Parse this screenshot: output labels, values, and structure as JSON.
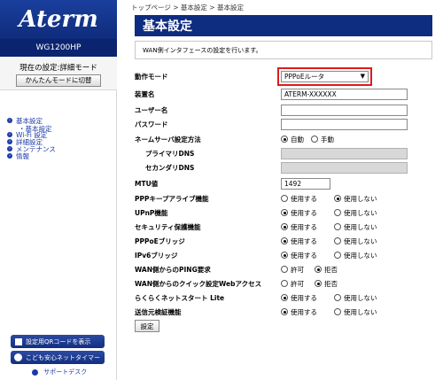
{
  "sidebar": {
    "logo": "Aterm",
    "model": "WG1200HP",
    "mode_text": "現在の設定:詳細モード",
    "mode_button": "かんたんモードに切替",
    "menu": [
      {
        "label": "基本設定"
      },
      {
        "label": "・基本設定",
        "sub": true
      },
      {
        "label": "Wi-Fi 設定"
      },
      {
        "label": "詳細設定"
      },
      {
        "label": "メンテナンス"
      },
      {
        "label": "情報"
      }
    ],
    "qr_button": "設定用QRコードを表示",
    "kids_button": "こども安心ネットタイマー",
    "support": "サポートデスク"
  },
  "breadcrumb": "トップページ > 基本設定 > 基本設定",
  "title": "基本設定",
  "description": "WAN側インタフェースの設定を行います。",
  "form": {
    "mode": {
      "label": "動作モード",
      "value": "PPPoEルータ"
    },
    "device_name": {
      "label": "装置名",
      "value": "ATERM-XXXXXX"
    },
    "username": {
      "label": "ユーザー名",
      "value": ""
    },
    "password": {
      "label": "パスワード",
      "value": ""
    },
    "dns_method": {
      "label": "ネームサーバ設定方法",
      "opt1": "自動",
      "opt2": "手動"
    },
    "primary_dns": {
      "label": "プライマリDNS"
    },
    "secondary_dns": {
      "label": "セカンダリDNS"
    },
    "mtu": {
      "label": "MTU値",
      "value": "1492"
    },
    "ppp_keepalive": {
      "label": "PPPキープアライブ機能",
      "opt1": "使用する",
      "opt2": "使用しない",
      "selected": "opt2"
    },
    "upnp": {
      "label": "UPnP機能",
      "opt1": "使用する",
      "opt2": "使用しない",
      "selected": "opt1"
    },
    "security": {
      "label": "セキュリティ保護機能",
      "opt1": "使用する",
      "opt2": "使用しない",
      "selected": "opt1"
    },
    "pppoe_bridge": {
      "label": "PPPoEブリッジ",
      "opt1": "使用する",
      "opt2": "使用しない",
      "selected": "opt1"
    },
    "ipv6_bridge": {
      "label": "IPv6ブリッジ",
      "opt1": "使用する",
      "opt2": "使用しない",
      "selected": "opt1"
    },
    "wan_ping": {
      "label": "WAN側からのPING要求",
      "opt1": "許可",
      "opt2": "拒否",
      "selected": "opt2"
    },
    "wan_quick_web": {
      "label": "WAN側からのクイック設定Webアクセス",
      "opt1": "許可",
      "opt2": "拒否",
      "selected": "opt2"
    },
    "rakuraku_lite": {
      "label": "らくらくネットスタート Lite",
      "opt1": "使用する",
      "opt2": "使用しない",
      "selected": "opt1"
    },
    "source_verify": {
      "label": "送信元検証機能",
      "opt1": "使用する",
      "opt2": "使用しない",
      "selected": "opt1"
    }
  },
  "submit": "設定",
  "colors": {
    "brand": "#0e2c80",
    "highlight": "#e01b1b"
  }
}
